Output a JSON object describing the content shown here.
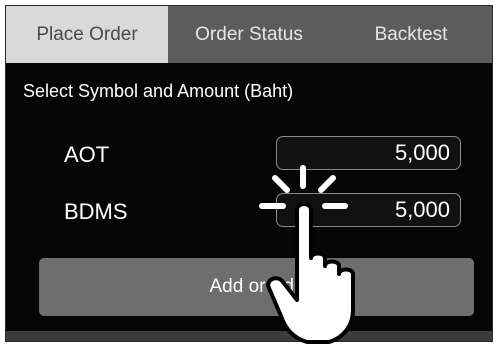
{
  "tabs": [
    {
      "label": "Place Order",
      "active": true
    },
    {
      "label": "Order Status",
      "active": false
    },
    {
      "label": "Backtest",
      "active": false
    }
  ],
  "prompt": "Select Symbol and Amount (Baht)",
  "rows": [
    {
      "symbol": "AOT",
      "amount": "5,000"
    },
    {
      "symbol": "BDMS",
      "amount": "5,000"
    }
  ],
  "add_button_label": "Add or Edit",
  "icons": {
    "pointer": "tapping-hand-icon"
  },
  "colors": {
    "background": "#050505",
    "tab_active": "#d9d9d9",
    "tab_inactive": "#5c5c5c",
    "button": "#6e6e6e"
  }
}
